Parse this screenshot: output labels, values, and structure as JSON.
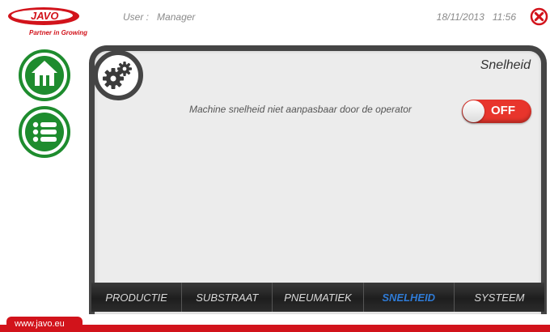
{
  "header": {
    "logo_text": "JAVO",
    "tagline": "Partner in Growing",
    "user_label": "User :",
    "user_name": "Manager",
    "date": "18/11/2013",
    "time": "11:56"
  },
  "nav": {
    "items": [
      {
        "name": "home",
        "icon": "home-icon"
      },
      {
        "name": "menu",
        "icon": "list-icon"
      }
    ]
  },
  "panel": {
    "icon": "gears-icon",
    "title": "Snelheid",
    "setting": {
      "label": "Machine snelheid niet aanpasbaar door de operator",
      "state": "OFF",
      "on": false
    }
  },
  "tabs": [
    {
      "label": "PRODUCTIE",
      "active": false
    },
    {
      "label": "SUBSTRAAT",
      "active": false
    },
    {
      "label": "PNEUMATIEK",
      "active": false
    },
    {
      "label": "SNELHEID",
      "active": true
    },
    {
      "label": "SYSTEEM",
      "active": false
    }
  ],
  "footer": {
    "url": "www.javo.eu"
  },
  "colors": {
    "brand_red": "#d2131b",
    "nav_green": "#1e8c2e",
    "active_tab": "#2f7bd6",
    "panel_border": "#454545"
  }
}
